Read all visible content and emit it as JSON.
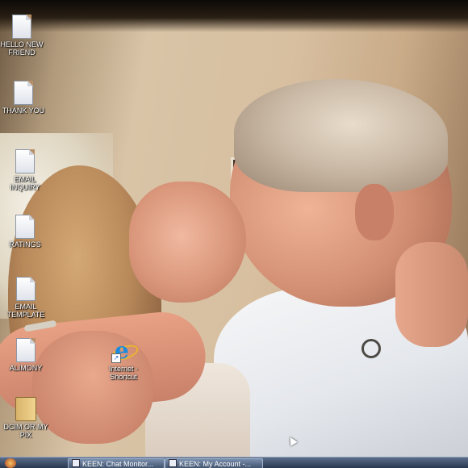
{
  "desktop": {
    "icons": [
      {
        "label": "HELLO NEW FRIEND",
        "icon": "document-icon"
      },
      {
        "label": "THANK YOU",
        "icon": "document-icon"
      },
      {
        "label": "EMAIL INQUIRY",
        "icon": "document-icon"
      },
      {
        "label": "RATINGS",
        "icon": "document-icon"
      },
      {
        "label": "EMAIL TEMPLATE",
        "icon": "document-icon"
      },
      {
        "label": "ALIMONY",
        "icon": "document-icon"
      },
      {
        "label": "DCIM OR MY PIX",
        "icon": "folder-icon"
      }
    ],
    "shortcut": {
      "label": "Internet - Shortcut",
      "icon": "internet-explorer-icon"
    }
  },
  "taskbar": {
    "items": [
      {
        "label": "KEEN: Chat Monitor..."
      },
      {
        "label": "KEEN: My Account -..."
      }
    ]
  },
  "colors": {
    "taskbar": "#27354c",
    "ie_blue": "#1a8be0"
  }
}
